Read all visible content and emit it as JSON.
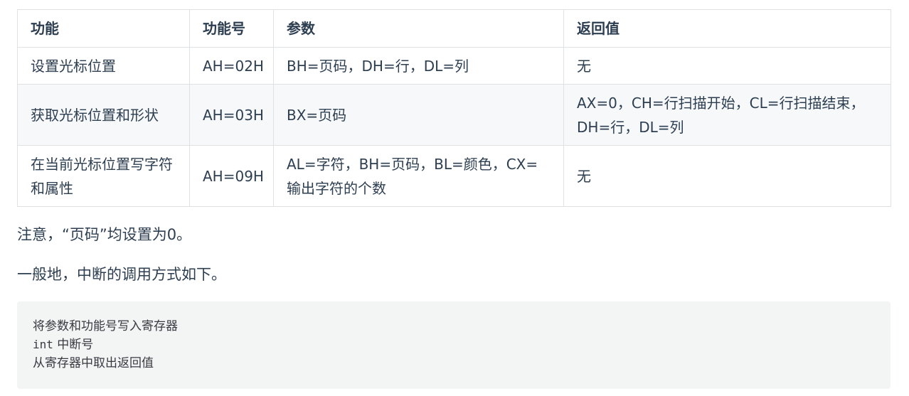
{
  "table": {
    "headers": [
      "功能",
      "功能号",
      "参数",
      "返回值"
    ],
    "rows": [
      [
        "设置光标位置",
        "AH=02H",
        "BH=页码，DH=行，DL=列",
        "无"
      ],
      [
        "获取光标位置和形状",
        "AH=03H",
        "BX=页码",
        "AX=0，CH=行扫描开始，CL=行扫描结束，DH=行，DL=列"
      ],
      [
        "在当前光标位置写字符和属性",
        "AH=09H",
        "AL=字符，BH=页码，BL=颜色，CX=输出字符的个数",
        "无"
      ]
    ]
  },
  "notes": {
    "note1": "注意，“页码”均设置为0。",
    "note2": "一般地，中断的调用方式如下。"
  },
  "code": {
    "line1": "将参数和功能号写入寄存器",
    "line2_keyword": "int",
    "line2_rest": " 中断号",
    "line3": "从寄存器中取出返回值"
  }
}
